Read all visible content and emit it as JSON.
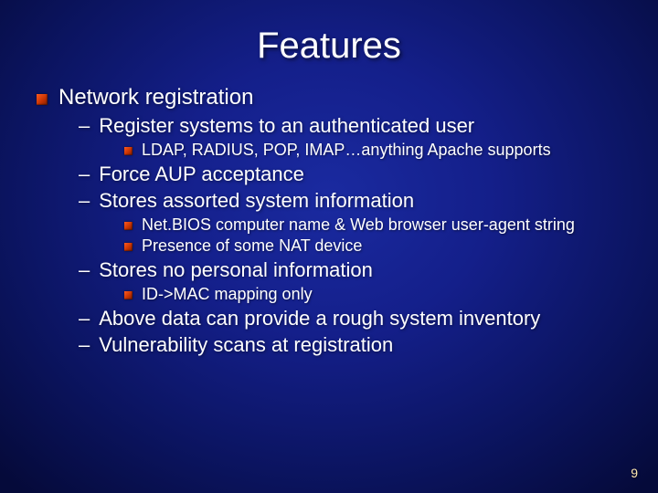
{
  "title": "Features",
  "page_number": "9",
  "lvl1": "Network registration",
  "items": [
    {
      "type": "lvl2",
      "text": "Register systems to an authenticated user"
    },
    {
      "type": "lvl3",
      "text": "LDAP, RADIUS, POP, IMAP…anything Apache supports"
    },
    {
      "type": "lvl2",
      "text": "Force AUP acceptance"
    },
    {
      "type": "lvl2",
      "text": "Stores assorted system information"
    },
    {
      "type": "lvl3",
      "text": "Net.BIOS computer name &  Web browser user-agent string"
    },
    {
      "type": "lvl3",
      "text": "Presence of some NAT device"
    },
    {
      "type": "lvl2",
      "text": "Stores no personal information"
    },
    {
      "type": "lvl3",
      "text": "ID->MAC mapping only"
    },
    {
      "type": "lvl2",
      "text": "Above data can provide a rough system inventory"
    },
    {
      "type": "lvl2",
      "text": "Vulnerability scans at registration"
    }
  ]
}
